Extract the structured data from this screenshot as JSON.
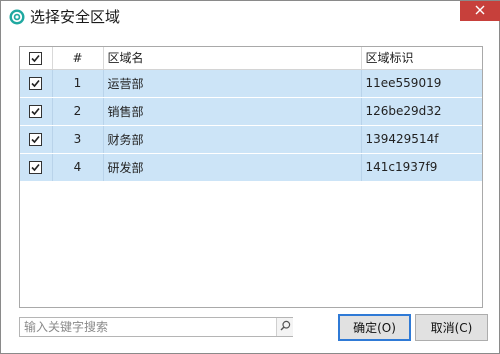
{
  "window": {
    "title": "选择安全区域",
    "accent": "#c7403b",
    "selection_color": "#cce4f7"
  },
  "table": {
    "columns": {
      "select": "",
      "index": "#",
      "name": "区域名",
      "tag": "区域标识"
    },
    "header_checked": true,
    "rows": [
      {
        "checked": true,
        "index": "1",
        "name": "运营部",
        "tag": "11ee559019"
      },
      {
        "checked": true,
        "index": "2",
        "name": "销售部",
        "tag": "126be29d32"
      },
      {
        "checked": true,
        "index": "3",
        "name": "财务部",
        "tag": "139429514f"
      },
      {
        "checked": true,
        "index": "4",
        "name": "研发部",
        "tag": "141c1937f9"
      }
    ]
  },
  "search": {
    "placeholder": "输入关键字搜索",
    "value": "",
    "icon": "search-icon"
  },
  "buttons": {
    "ok": "确定(O)",
    "cancel": "取消(C)"
  }
}
